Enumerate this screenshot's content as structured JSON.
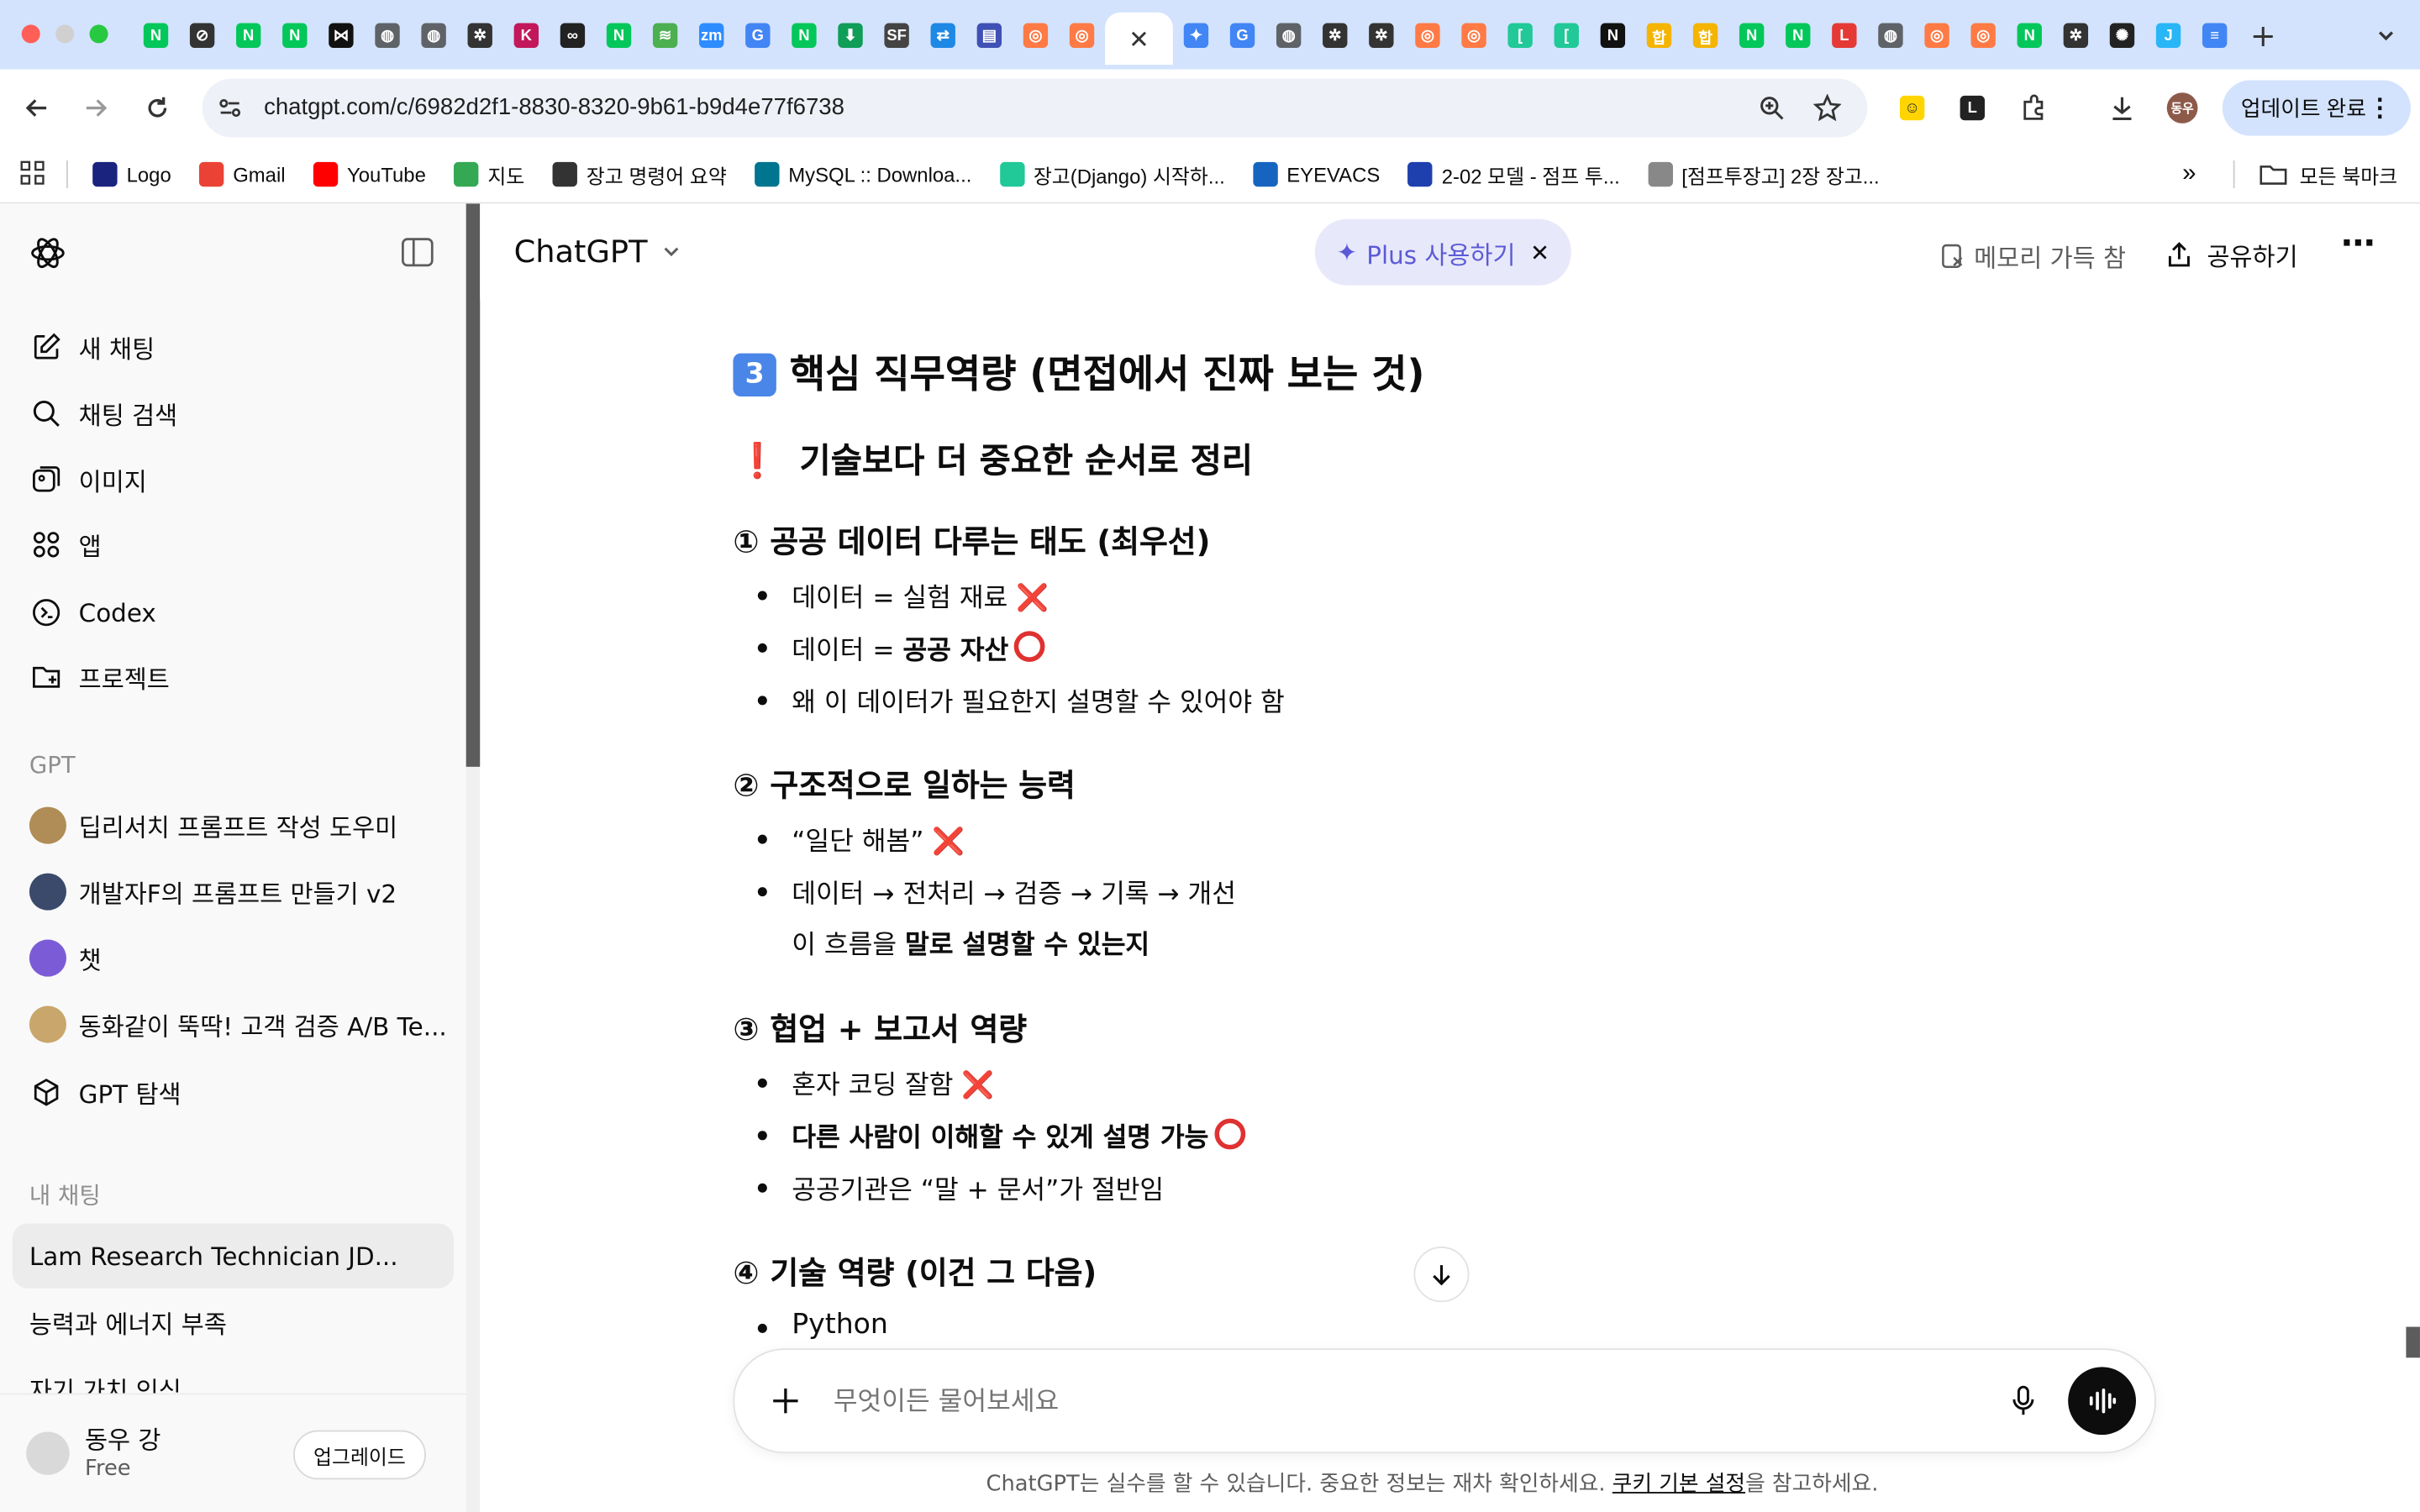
{
  "browser": {
    "url": "chatgpt.com/c/6982d2f1-8830-8320-9b61-b9d4e77f6738",
    "update_label": "업데이트 완료",
    "tabs": [
      {
        "icon": "naver-icon",
        "color": "#03c75a",
        "char": "N"
      },
      {
        "icon": "compass-icon",
        "color": "#333333",
        "char": "⊘"
      },
      {
        "icon": "naver-icon",
        "color": "#03c75a",
        "char": "N"
      },
      {
        "icon": "naver-icon",
        "color": "#03c75a",
        "char": "N"
      },
      {
        "icon": "bow-icon",
        "color": "#111111",
        "char": "⋈"
      },
      {
        "icon": "globe-icon",
        "color": "#5f6368",
        "char": "◍"
      },
      {
        "icon": "globe-icon",
        "color": "#5f6368",
        "char": "◍"
      },
      {
        "icon": "openai-icon",
        "color": "#333333",
        "char": "✲"
      },
      {
        "icon": "k-icon",
        "color": "#c2185b",
        "char": "K"
      },
      {
        "icon": "infinity-icon",
        "color": "#222222",
        "char": "∞"
      },
      {
        "icon": "naver-icon",
        "color": "#03c75a",
        "char": "N"
      },
      {
        "icon": "chart-icon",
        "color": "#4caf50",
        "char": "≋"
      },
      {
        "icon": "zoom-icon",
        "color": "#2d8cff",
        "char": "zm"
      },
      {
        "icon": "google-icon",
        "color": "#4285f4",
        "char": "G"
      },
      {
        "icon": "naver-icon",
        "color": "#03c75a",
        "char": "N"
      },
      {
        "icon": "download-icon",
        "color": "#0f9d58",
        "char": "⬇"
      },
      {
        "icon": "sf-icon",
        "color": "#444444",
        "char": "SF"
      },
      {
        "icon": "arrow-icon",
        "color": "#1e88e5",
        "char": "⇄"
      },
      {
        "icon": "doc-icon",
        "color": "#3f51b5",
        "char": "▤"
      },
      {
        "icon": "orange-icon",
        "color": "#ff7a45",
        "char": "◎"
      },
      {
        "icon": "orange-icon",
        "color": "#ff7a45",
        "char": "◎"
      }
    ],
    "tabs_after": [
      {
        "icon": "gemini-icon",
        "color": "#4285f4",
        "char": "✦"
      },
      {
        "icon": "google-icon",
        "color": "#4285f4",
        "char": "G"
      },
      {
        "icon": "globe-icon",
        "color": "#5f6368",
        "char": "◍"
      },
      {
        "icon": "openai-icon",
        "color": "#333333",
        "char": "✲"
      },
      {
        "icon": "openai-icon",
        "color": "#333333",
        "char": "✲"
      },
      {
        "icon": "orange-icon",
        "color": "#ff7a45",
        "char": "◎"
      },
      {
        "icon": "orange-icon",
        "color": "#ff7a45",
        "char": "◎"
      },
      {
        "icon": "bracket-icon",
        "color": "#20c997",
        "char": "["
      },
      {
        "icon": "bracket-icon",
        "color": "#20c997",
        "char": "["
      },
      {
        "icon": "notion-icon",
        "color": "#111111",
        "char": "N"
      },
      {
        "icon": "pass-icon",
        "color": "#f4b400",
        "char": "합"
      },
      {
        "icon": "pass-icon",
        "color": "#f4b400",
        "char": "합"
      },
      {
        "icon": "naver-icon",
        "color": "#03c75a",
        "char": "N"
      },
      {
        "icon": "naver-icon",
        "color": "#03c75a",
        "char": "N"
      },
      {
        "icon": "let-icon",
        "color": "#e53935",
        "char": "L"
      },
      {
        "icon": "globe-icon",
        "color": "#5f6368",
        "char": "◍"
      },
      {
        "icon": "orange-icon",
        "color": "#ff7a45",
        "char": "◎"
      },
      {
        "icon": "orange-icon",
        "color": "#ff7a45",
        "char": "◎"
      },
      {
        "icon": "naver-icon",
        "color": "#03c75a",
        "char": "N"
      },
      {
        "icon": "openai-icon",
        "color": "#333333",
        "char": "✲"
      },
      {
        "icon": "spark-icon",
        "color": "#222222",
        "char": "✺"
      },
      {
        "icon": "j-icon",
        "color": "#29b6f6",
        "char": "J"
      },
      {
        "icon": "docs-icon",
        "color": "#4285f4",
        "char": "≡"
      }
    ],
    "bookmarks": [
      {
        "label": "Logo",
        "icon": "logo-icon",
        "color": "#1a237e"
      },
      {
        "label": "Gmail",
        "icon": "gmail-icon",
        "color": "#ea4335"
      },
      {
        "label": "YouTube",
        "icon": "youtube-icon",
        "color": "#ff0000"
      },
      {
        "label": "지도",
        "icon": "maps-pin-icon",
        "color": "#34a853"
      },
      {
        "label": "장고 명령어 요약",
        "icon": "openai-icon",
        "color": "#333333"
      },
      {
        "label": "MySQL :: Downloa...",
        "icon": "mysql-icon",
        "color": "#00758f"
      },
      {
        "label": "장고(Django) 시작하...",
        "icon": "v-icon",
        "color": "#20c997"
      },
      {
        "label": "EYEVACS",
        "icon": "eyevacs-icon",
        "color": "#1565c0"
      },
      {
        "label": "2-02 모델 - 점프 투...",
        "icon": "book-icon",
        "color": "#1e40af"
      },
      {
        "label": "[점프투장고] 2장 장고...",
        "icon": "pencil-icon",
        "color": "#888888"
      }
    ],
    "all_bookmarks_label": "모든 북마크"
  },
  "sidebar": {
    "nav": [
      {
        "label": "새 채팅",
        "icon": "new-chat-icon"
      },
      {
        "label": "채팅 검색",
        "icon": "search-icon"
      },
      {
        "label": "이미지",
        "icon": "image-icon"
      },
      {
        "label": "앱",
        "icon": "apps-icon"
      },
      {
        "label": "Codex",
        "icon": "codex-icon"
      },
      {
        "label": "프로젝트",
        "icon": "folder-plus-icon"
      }
    ],
    "gpt_section": "GPT",
    "gpts": [
      {
        "label": "딥리서치 프롬프트 작성 도우미",
        "color": "#b08d57"
      },
      {
        "label": "개발자F의 프롬프트 만들기 v2",
        "color": "#3b4a6b"
      },
      {
        "label": "챗",
        "color": "#7c5cd6"
      },
      {
        "label": "동화같이 뚝딱! 고객 검증 A/B Te...",
        "color": "#c9a66b"
      }
    ],
    "explore_gpt": "GPT 탐색",
    "chats_section": "내 채팅",
    "chats": [
      "Lam Research Technician JD...",
      "능력과 에너지 부족",
      "자기 가치 인식"
    ],
    "user_name": "동우 강",
    "user_plan": "Free",
    "upgrade_label": "업그레이드"
  },
  "header": {
    "model": "ChatGPT",
    "plus_label": "Plus 사용하기",
    "memory_label": "메모리 가득 참",
    "share_label": "공유하기"
  },
  "content": {
    "title_num": "3",
    "title": "핵심 직무역량 (면접에서 진짜 보는 것)",
    "subtitle": "기술보다 더 중요한 순서로 정리",
    "s1_title": "① 공공 데이터 다루는 태도 (최우선)",
    "s1_i1": "데이터 = 실험 재료",
    "s1_i2a": "데이터 = ",
    "s1_i2b": "공공 자산",
    "s1_i3": "왜 이 데이터가 필요한지 설명할 수 있어야 함",
    "s2_title": "② 구조적으로 일하는 능력",
    "s2_i1": "“일단 해봄”",
    "s2_i2": "데이터 → 전처리 → 검증 → 기록 → 개선",
    "s2_i2b_a": "이 흐름을 ",
    "s2_i2b_b": "말로 설명할 수 있는지",
    "s3_title": "③ 협업 + 보고서 역량",
    "s3_i1": "혼자 코딩 잘함",
    "s3_i2": "다른 사람이 이해할 수 있게 설명 가능",
    "s3_i3": "공공기관은 “말 + 문서”가 절반임",
    "s4_title": "④ 기술 역량 (이건 그 다음)",
    "s4_i1": "Python",
    "x_mark": "❌"
  },
  "composer": {
    "placeholder": "무엇이든 물어보세요"
  },
  "footer": {
    "note_a": "ChatGPT는 실수를 할 수 있습니다. 중요한 정보는 재차 확인하세요. ",
    "note_link": "쿠키 기본 설정",
    "note_b": "을 참고하세요."
  }
}
